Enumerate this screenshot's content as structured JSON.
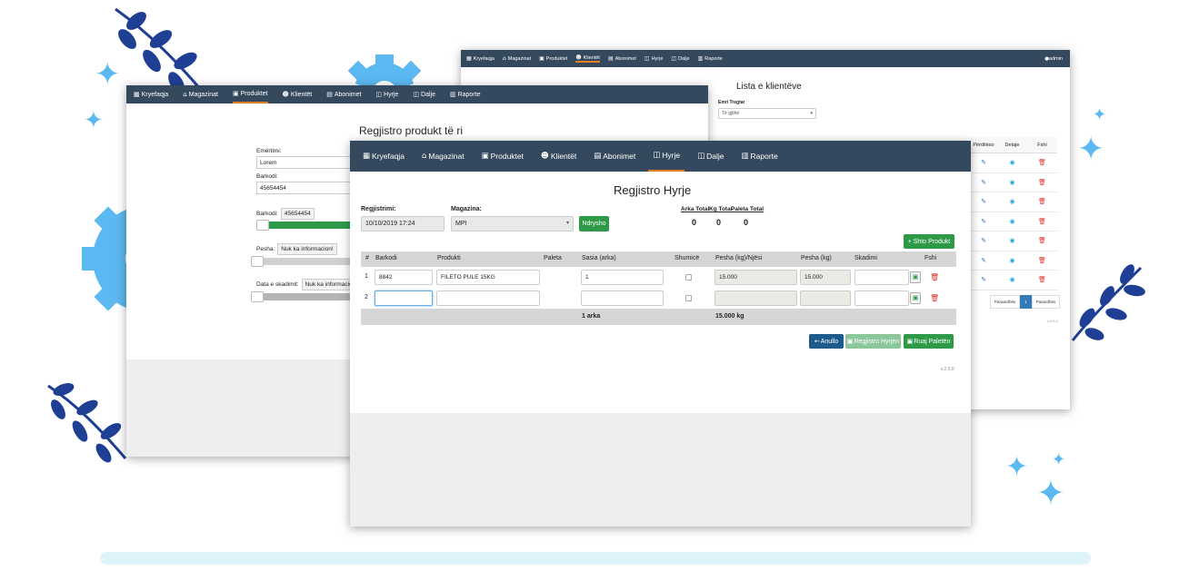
{
  "colors": {
    "nav_bg": "#34495e",
    "active_underline": "#e67e22",
    "primary_green": "#2e9a48",
    "primary_blue": "#1e5a8a",
    "decor_blue": "#5bb8f0",
    "decor_navy": "#1f3f95"
  },
  "clients_window": {
    "nav": [
      {
        "icon": "grid-icon",
        "label": "Kryefaqja"
      },
      {
        "icon": "home-icon",
        "label": "Magazinat"
      },
      {
        "icon": "box-icon",
        "label": "Produktet"
      },
      {
        "icon": "users-icon",
        "label": "Klientët"
      },
      {
        "icon": "calendar-icon",
        "label": "Abonimet"
      },
      {
        "icon": "bag-icon",
        "label": "Hyrje"
      },
      {
        "icon": "bag-icon",
        "label": "Dalje"
      },
      {
        "icon": "chart-icon",
        "label": "Raporte"
      }
    ],
    "user": "admin",
    "title": "Lista e klientëve",
    "filter_label": "Emri Tregtar",
    "filter_value": "Të gjithë",
    "columns": [
      "Përditëso",
      "Detaje",
      "Fshi"
    ],
    "row_count": 7,
    "pager": [
      "Paraardhës",
      "1",
      "Pasardhës"
    ],
    "version": "v.2.0.0"
  },
  "product_window": {
    "nav": [
      {
        "icon": "grid-icon",
        "label": "Kryefaqja"
      },
      {
        "icon": "home-icon",
        "label": "Magazinat"
      },
      {
        "icon": "box-icon",
        "label": "Produktet"
      },
      {
        "icon": "users-icon",
        "label": "Klientët"
      },
      {
        "icon": "calendar-icon",
        "label": "Abonimet"
      },
      {
        "icon": "bag-icon",
        "label": "Hyrje"
      },
      {
        "icon": "bag-icon",
        "label": "Dalje"
      },
      {
        "icon": "chart-icon",
        "label": "Raporte"
      }
    ],
    "title": "Regjistro produkt të ri",
    "name_label": "Emërtimi:",
    "name_value": "Lorem",
    "barcode_label": "Barkodi:",
    "barcode_value": "45654454",
    "barcode_info_label": "Barkodi:",
    "barcode_info_value": "45654454",
    "weight_label": "Pesha:",
    "weight_value": "Nuk ka informacion!",
    "expiry_label": "Data e skadimit:",
    "expiry_value": "Nuk ka informacion"
  },
  "entry_window": {
    "nav": [
      {
        "icon": "grid-icon",
        "label": "Kryefaqja"
      },
      {
        "icon": "home-icon",
        "label": "Magazinat"
      },
      {
        "icon": "box-icon",
        "label": "Produktet"
      },
      {
        "icon": "users-icon",
        "label": "Klientët"
      },
      {
        "icon": "calendar-icon",
        "label": "Abonimet"
      },
      {
        "icon": "bag-icon",
        "label": "Hyrje"
      },
      {
        "icon": "bag-icon",
        "label": "Dalje"
      },
      {
        "icon": "chart-icon",
        "label": "Raporte"
      }
    ],
    "active_tab": "Hyrje",
    "title": "Regjistro Hyrje",
    "registration_label": "Regjistrimi:",
    "registration_value": "10/10/2019 17:24",
    "warehouse_label": "Magazina:",
    "warehouse_value": "MPI",
    "change_button": "Ndrysho",
    "totals": {
      "headers": [
        "Arka Total",
        "Kg Total",
        "Paleta Total"
      ],
      "values": [
        "0",
        "0",
        "0"
      ]
    },
    "add_product_button": "+ Shto Produkt",
    "columns": [
      "#",
      "Barkodi",
      "Produkti",
      "Paleta",
      "Sasia (arka)",
      "Shumicë",
      "Pesha (kg)/Njësi",
      "Pesha (kg)",
      "Skadimi",
      "Fshi"
    ],
    "rows": [
      {
        "num": "1",
        "barcode": "8842",
        "product": "FILETO PULE 15KG",
        "quantity": "1",
        "unit_weight": "15.000",
        "weight": "15.000"
      },
      {
        "num": "2",
        "barcode": "",
        "product": "",
        "quantity": "",
        "unit_weight": "",
        "weight": ""
      }
    ],
    "footer": {
      "quantity_total": "1 arka",
      "weight_total": "15.000 kg"
    },
    "cancel_button": "Anullo",
    "register_button": "Regjistro Hyrjen",
    "save_pallet_button": "Ruaj Paletën",
    "version": "v.2.0.0"
  }
}
